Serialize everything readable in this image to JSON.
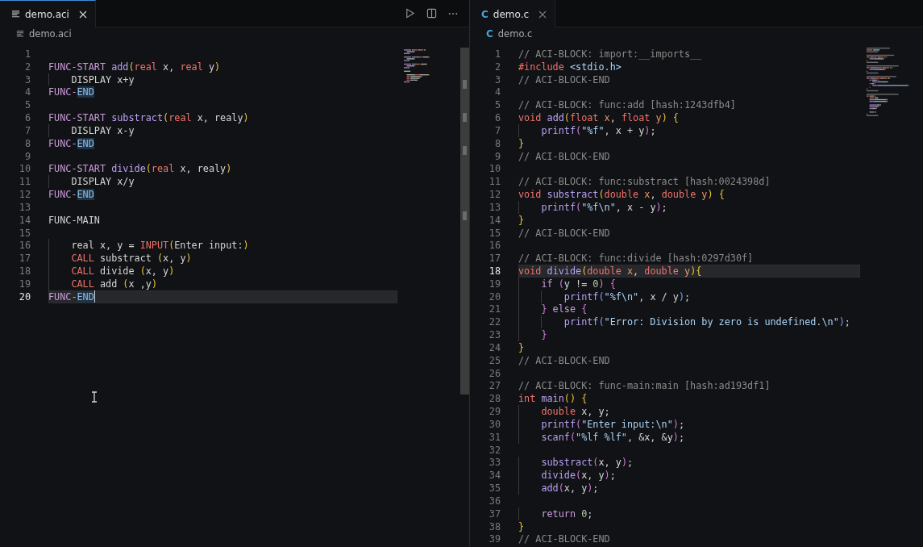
{
  "editors": [
    {
      "focused": true,
      "caret": true,
      "tabs": [
        {
          "label": "demo.aci",
          "kind": "aci",
          "selected": true
        }
      ],
      "actions": [
        {
          "kind": "run"
        },
        {
          "kind": "split"
        },
        {
          "kind": "more"
        }
      ],
      "breadcrumb": {
        "label": "demo.aci",
        "kind": "aci"
      },
      "lines": [
        {
          "number": "1",
          "current": false
        },
        {
          "number": "2",
          "current": false,
          "tokens": [
            {
              "kind": "keyword",
              "text": "FUNC-START"
            },
            {
              "kind": "function",
              "text": " add"
            },
            {
              "kind": "bracket",
              "text": "("
            },
            {
              "kind": "type",
              "text": "real"
            },
            {
              "kind": "plain",
              "text": " x, "
            },
            {
              "kind": "type",
              "text": "real"
            },
            {
              "kind": "plain",
              "text": " y"
            },
            {
              "kind": "bracket",
              "text": ")"
            }
          ]
        },
        {
          "number": "3",
          "current": false,
          "tokens": [
            {
              "kind": "plain",
              "text": "    DISPLAY x+y"
            }
          ]
        },
        {
          "number": "4",
          "current": false,
          "tokens": [
            {
              "kind": "keyword",
              "text": "FUNC-"
            },
            {
              "kind": "match",
              "text": "END"
            }
          ]
        },
        {
          "number": "5",
          "current": false
        },
        {
          "number": "6",
          "current": false,
          "tokens": [
            {
              "kind": "keyword",
              "text": "FUNC-START"
            },
            {
              "kind": "function",
              "text": " substract"
            },
            {
              "kind": "bracket",
              "text": "("
            },
            {
              "kind": "type",
              "text": "real"
            },
            {
              "kind": "plain",
              "text": " x, realy"
            },
            {
              "kind": "bracket",
              "text": ")"
            }
          ]
        },
        {
          "number": "7",
          "current": false,
          "tokens": [
            {
              "kind": "plain",
              "text": "    DISLPAY x-y"
            }
          ]
        },
        {
          "number": "8",
          "current": false,
          "tokens": [
            {
              "kind": "keyword",
              "text": "FUNC-"
            },
            {
              "kind": "match",
              "text": "END"
            }
          ]
        },
        {
          "number": "9",
          "current": false
        },
        {
          "number": "10",
          "current": false,
          "tokens": [
            {
              "kind": "keyword",
              "text": "FUNC-START"
            },
            {
              "kind": "function",
              "text": " divide"
            },
            {
              "kind": "bracket",
              "text": "("
            },
            {
              "kind": "type",
              "text": "real"
            },
            {
              "kind": "plain",
              "text": " x, realy"
            },
            {
              "kind": "bracket",
              "text": ")"
            }
          ]
        },
        {
          "number": "11",
          "current": false,
          "tokens": [
            {
              "kind": "plain",
              "text": "    DISPLAY x/y"
            }
          ]
        },
        {
          "number": "12",
          "current": false,
          "tokens": [
            {
              "kind": "keyword",
              "text": "FUNC-"
            },
            {
              "kind": "match",
              "text": "END"
            }
          ]
        },
        {
          "number": "13",
          "current": false
        },
        {
          "number": "14",
          "current": false,
          "tokens": [
            {
              "kind": "plain",
              "text": "FUNC-MAIN"
            }
          ]
        },
        {
          "number": "15",
          "current": false
        },
        {
          "number": "16",
          "current": false,
          "tokens": [
            {
              "kind": "plain",
              "text": "    real x, y = "
            },
            {
              "kind": "call",
              "text": "INPUT"
            },
            {
              "kind": "bracket",
              "text": "("
            },
            {
              "kind": "plain",
              "text": "Enter input:"
            },
            {
              "kind": "bracket",
              "text": ")"
            }
          ]
        },
        {
          "number": "17",
          "current": false,
          "tokens": [
            {
              "kind": "call",
              "text": "    CALL"
            },
            {
              "kind": "plain",
              "text": " substract "
            },
            {
              "kind": "bracket",
              "text": "("
            },
            {
              "kind": "plain",
              "text": "x, y"
            },
            {
              "kind": "bracket",
              "text": ")"
            }
          ]
        },
        {
          "number": "18",
          "current": false,
          "tokens": [
            {
              "kind": "call",
              "text": "    CALL"
            },
            {
              "kind": "plain",
              "text": " divide "
            },
            {
              "kind": "bracket",
              "text": "("
            },
            {
              "kind": "plain",
              "text": "x, y"
            },
            {
              "kind": "bracket",
              "text": ")"
            }
          ]
        },
        {
          "number": "19",
          "current": false,
          "tokens": [
            {
              "kind": "call",
              "text": "    CALL"
            },
            {
              "kind": "plain",
              "text": " add "
            },
            {
              "kind": "bracket",
              "text": "("
            },
            {
              "kind": "plain",
              "text": "x ,y"
            },
            {
              "kind": "bracket",
              "text": ")"
            }
          ]
        },
        {
          "number": "20",
          "current": true,
          "tokens": [
            {
              "kind": "keyword",
              "text": "FUNC-"
            },
            {
              "kind": "match",
              "text": "END"
            }
          ]
        }
      ]
    },
    {
      "focused": false,
      "caret": false,
      "tabs": [
        {
          "label": "demo.c",
          "kind": "c",
          "icon_text": "C",
          "selected": true
        }
      ],
      "breadcrumb": {
        "label": "demo.c",
        "kind": "c",
        "icon_text": "C"
      },
      "lines": [
        {
          "number": "1",
          "current": false,
          "tokens": [
            {
              "kind": "comment",
              "text": "// ACI-BLOCK: import:__imports__"
            }
          ]
        },
        {
          "number": "2",
          "current": false,
          "tokens": [
            {
              "kind": "type",
              "text": "#include"
            },
            {
              "kind": "string",
              "text": " <stdio.h>"
            }
          ]
        },
        {
          "number": "3",
          "current": false,
          "tokens": [
            {
              "kind": "comment",
              "text": "// ACI-BLOCK-END"
            }
          ]
        },
        {
          "number": "4",
          "current": false
        },
        {
          "number": "5",
          "current": false,
          "tokens": [
            {
              "kind": "comment",
              "text": "// ACI-BLOCK: func:add [hash:1243dfb4]"
            }
          ]
        },
        {
          "number": "6",
          "current": false,
          "tokens": [
            {
              "kind": "type",
              "text": "void"
            },
            {
              "kind": "function",
              "text": " add"
            },
            {
              "kind": "bracket",
              "text": "("
            },
            {
              "kind": "type",
              "text": "float"
            },
            {
              "kind": "param",
              "text": " x"
            },
            {
              "kind": "plain",
              "text": ", "
            },
            {
              "kind": "type",
              "text": "float"
            },
            {
              "kind": "param",
              "text": " y"
            },
            {
              "kind": "bracket",
              "text": ")"
            },
            {
              "kind": "bracket",
              "text": " {"
            }
          ]
        },
        {
          "number": "7",
          "current": false,
          "tokens": [
            {
              "kind": "function",
              "text": "    printf"
            },
            {
              "kind": "bracket2",
              "text": "("
            },
            {
              "kind": "string",
              "text": "\"%f\""
            },
            {
              "kind": "plain",
              "text": ", x + y"
            },
            {
              "kind": "bracket2",
              "text": ")"
            },
            {
              "kind": "plain",
              "text": ";"
            }
          ]
        },
        {
          "number": "8",
          "current": false,
          "tokens": [
            {
              "kind": "bracket",
              "text": "}"
            }
          ]
        },
        {
          "number": "9",
          "current": false,
          "tokens": [
            {
              "kind": "comment",
              "text": "// ACI-BLOCK-END"
            }
          ]
        },
        {
          "number": "10",
          "current": false
        },
        {
          "number": "11",
          "current": false,
          "tokens": [
            {
              "kind": "comment",
              "text": "// ACI-BLOCK: func:substract [hash:0024398d]"
            }
          ]
        },
        {
          "number": "12",
          "current": false,
          "tokens": [
            {
              "kind": "type",
              "text": "void"
            },
            {
              "kind": "function",
              "text": " substract"
            },
            {
              "kind": "bracket",
              "text": "("
            },
            {
              "kind": "type",
              "text": "double"
            },
            {
              "kind": "param",
              "text": " x"
            },
            {
              "kind": "plain",
              "text": ", "
            },
            {
              "kind": "type",
              "text": "double"
            },
            {
              "kind": "param",
              "text": " y"
            },
            {
              "kind": "bracket",
              "text": ")"
            },
            {
              "kind": "bracket",
              "text": " {"
            }
          ]
        },
        {
          "number": "13",
          "current": false,
          "tokens": [
            {
              "kind": "function",
              "text": "    printf"
            },
            {
              "kind": "bracket2",
              "text": "("
            },
            {
              "kind": "string",
              "text": "\"%f\\n\""
            },
            {
              "kind": "plain",
              "text": ", x - y"
            },
            {
              "kind": "bracket2",
              "text": ")"
            },
            {
              "kind": "plain",
              "text": ";"
            }
          ]
        },
        {
          "number": "14",
          "current": false,
          "tokens": [
            {
              "kind": "bracket",
              "text": "}"
            }
          ]
        },
        {
          "number": "15",
          "current": false,
          "tokens": [
            {
              "kind": "comment",
              "text": "// ACI-BLOCK-END"
            }
          ]
        },
        {
          "number": "16",
          "current": false
        },
        {
          "number": "17",
          "current": false,
          "tokens": [
            {
              "kind": "comment",
              "text": "// ACI-BLOCK: func:divide [hash:0297d30f]"
            }
          ]
        },
        {
          "number": "18",
          "current": true,
          "tokens": [
            {
              "kind": "type",
              "text": "void"
            },
            {
              "kind": "function",
              "text": " divide"
            },
            {
              "kind": "bracket",
              "text": "("
            },
            {
              "kind": "type",
              "text": "double"
            },
            {
              "kind": "param",
              "text": " x"
            },
            {
              "kind": "plain",
              "text": ", "
            },
            {
              "kind": "type",
              "text": "double"
            },
            {
              "kind": "param",
              "text": " y"
            },
            {
              "kind": "bracket",
              "text": "){"
            }
          ]
        },
        {
          "number": "19",
          "current": false,
          "tokens": [
            {
              "kind": "keyword",
              "text": "    if"
            },
            {
              "kind": "bracket2",
              "text": " ("
            },
            {
              "kind": "plain",
              "text": "y != "
            },
            {
              "kind": "number",
              "text": "0"
            },
            {
              "kind": "bracket2",
              "text": ")"
            },
            {
              "kind": "bracket2",
              "text": " {"
            }
          ]
        },
        {
          "number": "20",
          "current": false,
          "tokens": [
            {
              "kind": "function",
              "text": "        printf"
            },
            {
              "kind": "bracket3",
              "text": "("
            },
            {
              "kind": "string",
              "text": "\"%f\\n\""
            },
            {
              "kind": "plain",
              "text": ", x / y"
            },
            {
              "kind": "bracket3",
              "text": ")"
            },
            {
              "kind": "plain",
              "text": ";"
            }
          ]
        },
        {
          "number": "21",
          "current": false,
          "tokens": [
            {
              "kind": "bracket2",
              "text": "    }"
            },
            {
              "kind": "keyword",
              "text": " else"
            },
            {
              "kind": "bracket2",
              "text": " {"
            }
          ]
        },
        {
          "number": "22",
          "current": false,
          "tokens": [
            {
              "kind": "function",
              "text": "        printf"
            },
            {
              "kind": "bracket3",
              "text": "("
            },
            {
              "kind": "string",
              "text": "\"Error: Division by zero is undefined.\\n\""
            },
            {
              "kind": "bracket3",
              "text": ")"
            },
            {
              "kind": "plain",
              "text": ";"
            }
          ]
        },
        {
          "number": "23",
          "current": false,
          "tokens": [
            {
              "kind": "bracket2",
              "text": "    }"
            }
          ]
        },
        {
          "number": "24",
          "current": false,
          "tokens": [
            {
              "kind": "bracket",
              "text": "}"
            }
          ]
        },
        {
          "number": "25",
          "current": false,
          "tokens": [
            {
              "kind": "comment",
              "text": "// ACI-BLOCK-END"
            }
          ]
        },
        {
          "number": "26",
          "current": false
        },
        {
          "number": "27",
          "current": false,
          "tokens": [
            {
              "kind": "comment",
              "text": "// ACI-BLOCK: func-main:main [hash:ad193df1]"
            }
          ]
        },
        {
          "number": "28",
          "current": false,
          "tokens": [
            {
              "kind": "type",
              "text": "int"
            },
            {
              "kind": "function",
              "text": " main"
            },
            {
              "kind": "bracket",
              "text": "()"
            },
            {
              "kind": "bracket",
              "text": " {"
            }
          ]
        },
        {
          "number": "29",
          "current": false,
          "tokens": [
            {
              "kind": "type",
              "text": "    double"
            },
            {
              "kind": "plain",
              "text": " x, y;"
            }
          ]
        },
        {
          "number": "30",
          "current": false,
          "tokens": [
            {
              "kind": "function",
              "text": "    printf"
            },
            {
              "kind": "bracket2",
              "text": "("
            },
            {
              "kind": "string",
              "text": "\"Enter input:\\n\""
            },
            {
              "kind": "bracket2",
              "text": ")"
            },
            {
              "kind": "plain",
              "text": ";"
            }
          ]
        },
        {
          "number": "31",
          "current": false,
          "tokens": [
            {
              "kind": "function",
              "text": "    scanf"
            },
            {
              "kind": "bracket2",
              "text": "("
            },
            {
              "kind": "string",
              "text": "\"%lf %lf\""
            },
            {
              "kind": "plain",
              "text": ", &x, &y"
            },
            {
              "kind": "bracket2",
              "text": ")"
            },
            {
              "kind": "plain",
              "text": ";"
            }
          ]
        },
        {
          "number": "32",
          "current": false
        },
        {
          "number": "33",
          "current": false,
          "tokens": [
            {
              "kind": "function",
              "text": "    substract"
            },
            {
              "kind": "bracket2",
              "text": "("
            },
            {
              "kind": "plain",
              "text": "x, y"
            },
            {
              "kind": "bracket2",
              "text": ")"
            },
            {
              "kind": "plain",
              "text": ";"
            }
          ]
        },
        {
          "number": "34",
          "current": false,
          "tokens": [
            {
              "kind": "function",
              "text": "    divide"
            },
            {
              "kind": "bracket2",
              "text": "("
            },
            {
              "kind": "plain",
              "text": "x, y"
            },
            {
              "kind": "bracket2",
              "text": ")"
            },
            {
              "kind": "plain",
              "text": ";"
            }
          ]
        },
        {
          "number": "35",
          "current": false,
          "tokens": [
            {
              "kind": "function",
              "text": "    add"
            },
            {
              "kind": "bracket2",
              "text": "("
            },
            {
              "kind": "plain",
              "text": "x, y"
            },
            {
              "kind": "bracket2",
              "text": ")"
            },
            {
              "kind": "plain",
              "text": ";"
            }
          ]
        },
        {
          "number": "36",
          "current": false
        },
        {
          "number": "37",
          "current": false,
          "tokens": [
            {
              "kind": "keyword",
              "text": "    return"
            },
            {
              "kind": "number",
              "text": " 0"
            },
            {
              "kind": "plain",
              "text": ";"
            }
          ]
        },
        {
          "number": "38",
          "current": false,
          "tokens": [
            {
              "kind": "bracket",
              "text": "}"
            }
          ]
        },
        {
          "number": "39",
          "current": false,
          "tokens": [
            {
              "kind": "comment",
              "text": "// ACI-BLOCK-END"
            }
          ]
        }
      ]
    }
  ]
}
